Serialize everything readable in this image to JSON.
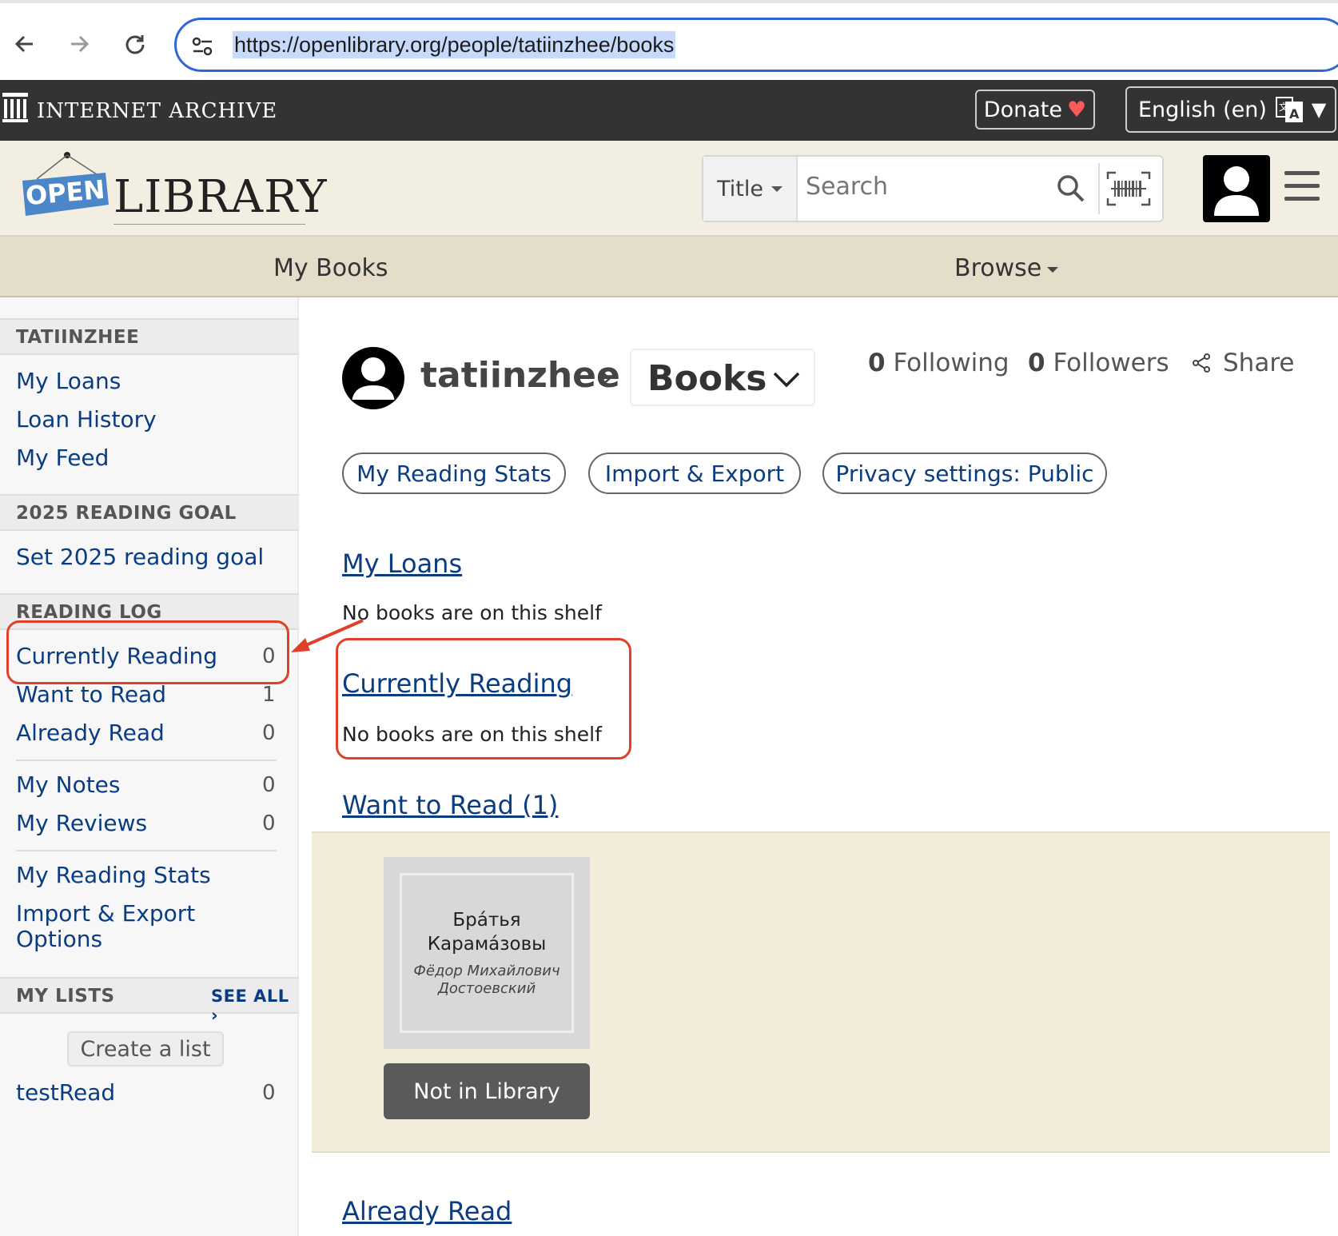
{
  "browser": {
    "url": "https://openlibrary.org/people/tatiinzhee/books",
    "back_icon": "arrow-left-icon",
    "forward_icon": "arrow-right-icon",
    "reload_icon": "reload-icon",
    "site_settings_icon": "tune-icon",
    "highlight_color": "#2f66d4"
  },
  "ia_bar": {
    "logo_text": "INTERNET ARCHIVE",
    "donate_label": "Donate",
    "donate_heart": "♥",
    "language_label": "English (en)",
    "language_caret": "▼"
  },
  "header": {
    "logo_open": "OPEN",
    "logo_library": "LIBRARY",
    "search_type": "Title",
    "search_placeholder": "Search",
    "search_icon": "search-icon",
    "barcode_icon": "barcode-icon"
  },
  "nav": {
    "my_books": "My Books",
    "browse": "Browse"
  },
  "sidebar": {
    "user_heading": "TATIINZHEE",
    "user_links": [
      "My Loans",
      "Loan History",
      "My Feed"
    ],
    "goal_heading": "2025 READING GOAL",
    "goal_link": "Set 2025 reading goal",
    "log_heading": "READING LOG",
    "log_items": [
      {
        "label": "Currently Reading",
        "count": "0"
      },
      {
        "label": "Want to Read",
        "count": "1"
      },
      {
        "label": "Already Read",
        "count": "0"
      }
    ],
    "notes_items": [
      {
        "label": "My Notes",
        "count": "0"
      },
      {
        "label": "My Reviews",
        "count": "0"
      }
    ],
    "stats_link": "My Reading Stats",
    "import_link_1": "Import & Export",
    "import_link_2": "Options",
    "lists_heading": "MY LISTS",
    "see_all": "SEE ALL ›",
    "create_list": "Create a list",
    "lists": [
      {
        "label": "testRead",
        "count": "0"
      }
    ]
  },
  "main": {
    "username": "tatiinzhee",
    "crumb_sep": "›",
    "books_dropdown": "Books",
    "following_count": "0",
    "following_label": "Following",
    "followers_count": "0",
    "followers_label": "Followers",
    "share_label": "Share",
    "pills": [
      "My Reading Stats",
      "Import & Export",
      "Privacy settings: Public"
    ],
    "shelves": {
      "my_loans": "My Loans",
      "my_loans_empty": "No books are on this shelf",
      "currently_reading": "Currently Reading",
      "currently_reading_empty": "No books are on this shelf",
      "want_to_read": "Want to Read (1)",
      "already_read": "Already Read"
    },
    "book": {
      "title_line1": "Бра́тья",
      "title_line2": "Карама́зовы",
      "author_line1": "Фёдор Михайлович",
      "author_line2": "Достоевский",
      "button": "Not in Library"
    }
  },
  "annotation_color": "#e0402a"
}
